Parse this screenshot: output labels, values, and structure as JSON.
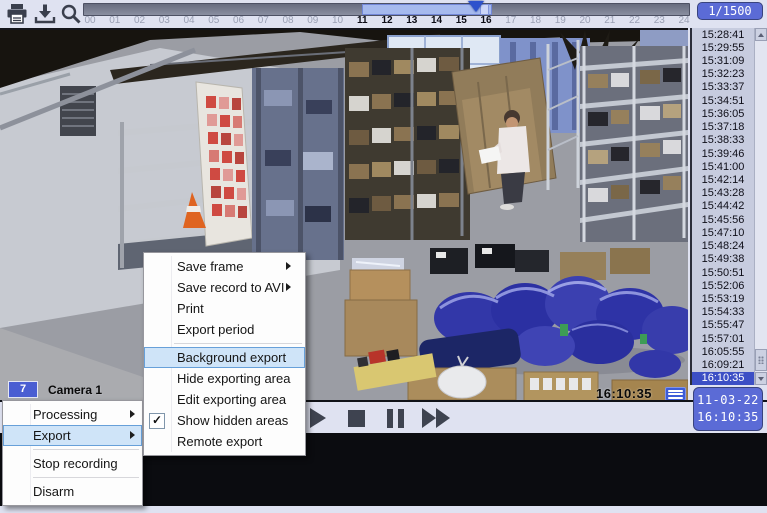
{
  "toolbar": {
    "frame_counter": "1/1500",
    "icons": [
      "print-icon",
      "save-export-icon",
      "zoom-icon"
    ]
  },
  "timeline": {
    "hours": [
      "00",
      "01",
      "02",
      "03",
      "04",
      "05",
      "06",
      "07",
      "08",
      "09",
      "10",
      "11",
      "12",
      "13",
      "14",
      "15",
      "16",
      "17",
      "18",
      "19",
      "20",
      "21",
      "22",
      "23",
      "24"
    ],
    "selection_start_hour": "11",
    "selection_end_hour": "16"
  },
  "video": {
    "osd_time": "16:10:35",
    "camera_number": "7",
    "camera_name": "Camera 1"
  },
  "sidebar": {
    "timestamps": [
      "15:28:41",
      "15:29:55",
      "15:31:09",
      "15:32:23",
      "15:33:37",
      "15:34:51",
      "15:36:05",
      "15:37:18",
      "15:38:33",
      "15:39:46",
      "15:41:00",
      "15:42:14",
      "15:43:28",
      "15:44:42",
      "15:45:56",
      "15:47:10",
      "15:48:24",
      "15:49:38",
      "15:50:51",
      "15:52:06",
      "15:53:19",
      "15:54:33",
      "15:55:47",
      "15:57:01",
      "16:05:55",
      "16:09:21",
      "16:10:35"
    ],
    "selected_timestamp": "16:10:35",
    "date_display": "11-03-22",
    "time_display": "16:10:35"
  },
  "playback": {
    "buttons": [
      "play",
      "stop",
      "pause",
      "fast-forward"
    ]
  },
  "camera_menu": {
    "items": [
      {
        "label": "Processing",
        "has_submenu": true
      },
      {
        "label": "Export",
        "has_submenu": true,
        "highlighted": true
      },
      {
        "type": "separator"
      },
      {
        "label": "Stop recording"
      },
      {
        "type": "separator"
      },
      {
        "label": "Disarm"
      }
    ]
  },
  "export_menu": {
    "items": [
      {
        "label": "Save frame",
        "has_submenu": true
      },
      {
        "label": "Save record to AVI",
        "has_submenu": true
      },
      {
        "label": "Print"
      },
      {
        "label": "Export period"
      },
      {
        "type": "separator"
      },
      {
        "label": "Background export",
        "highlighted": true
      },
      {
        "label": "Hide exporting area"
      },
      {
        "label": "Edit exporting area"
      },
      {
        "label": "Show hidden areas",
        "checked": true
      },
      {
        "label": "Remote export"
      }
    ]
  },
  "colors": {
    "accent_blue": "#5b6bd6",
    "selection_blue": "#3c4fc5",
    "menu_highlight": "#cfe4f8",
    "timeline_selection": "#a6baee"
  }
}
